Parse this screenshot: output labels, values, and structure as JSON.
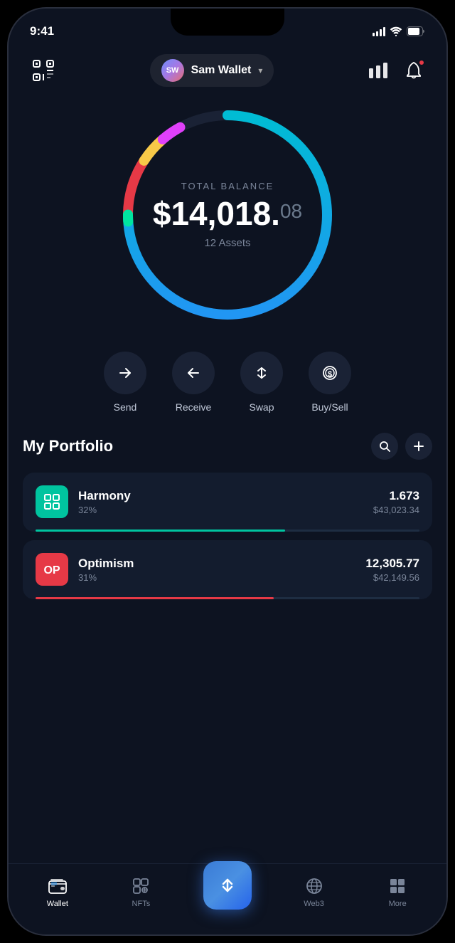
{
  "statusBar": {
    "time": "9:41",
    "signalBars": [
      4,
      6,
      9,
      12,
      14
    ],
    "batteryLevel": 80
  },
  "header": {
    "avatarText": "SW",
    "walletName": "Sam Wallet",
    "scanAriaLabel": "scan"
  },
  "balance": {
    "label": "TOTAL BALANCE",
    "main": "$14,018.",
    "cents": "08",
    "assets": "12 Assets"
  },
  "actions": [
    {
      "id": "send",
      "label": "Send"
    },
    {
      "id": "receive",
      "label": "Receive"
    },
    {
      "id": "swap",
      "label": "Swap"
    },
    {
      "id": "buysell",
      "label": "Buy/Sell"
    }
  ],
  "portfolio": {
    "title": "My Portfolio",
    "assets": [
      {
        "id": "harmony",
        "name": "Harmony",
        "pct": "32%",
        "amount": "1.673",
        "usd": "$43,023.34",
        "barClass": "harmony-bar",
        "iconClass": "harmony-icon"
      },
      {
        "id": "optimism",
        "name": "Optimism",
        "pct": "31%",
        "amount": "12,305.77",
        "usd": "$42,149.56",
        "barClass": "optimism-bar",
        "iconClass": "optimism-icon"
      }
    ]
  },
  "bottomNav": [
    {
      "id": "wallet",
      "label": "Wallet",
      "active": true
    },
    {
      "id": "nfts",
      "label": "NFTs",
      "active": false
    },
    {
      "id": "center",
      "label": "",
      "active": false
    },
    {
      "id": "web3",
      "label": "Web3",
      "active": false
    },
    {
      "id": "more",
      "label": "More",
      "active": false
    }
  ]
}
